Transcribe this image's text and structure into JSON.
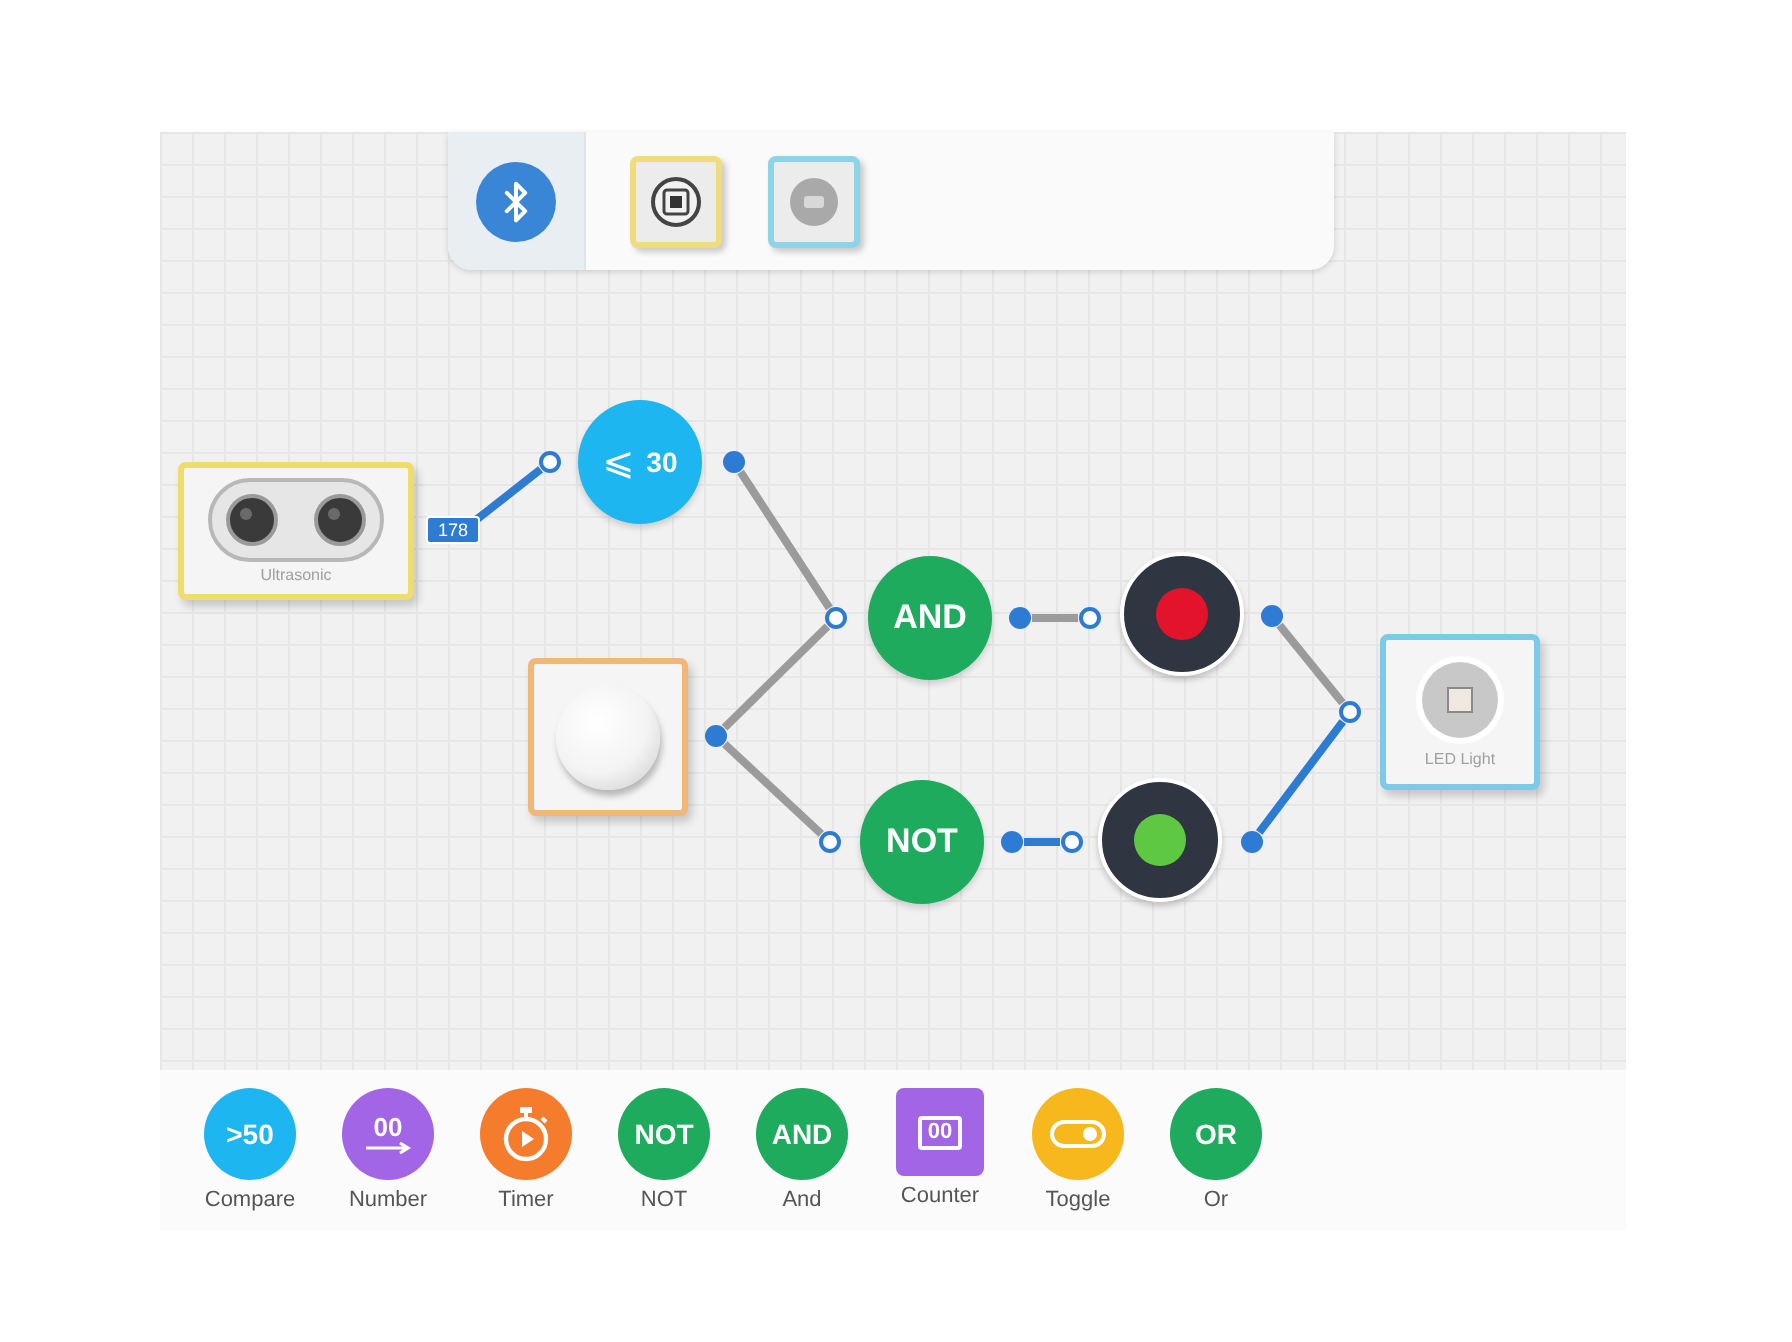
{
  "toolbar": {
    "tiles": [
      {
        "kind": "chip",
        "color": "#f0dc7c"
      },
      {
        "kind": "disc",
        "color": "#8ed4e8"
      }
    ]
  },
  "canvas": {
    "modules": [
      {
        "kind": "ultrasonic",
        "label": "Ultrasonic",
        "color": "#f0dc6a",
        "reading": "178"
      },
      {
        "kind": "button",
        "color": "#f2b777"
      },
      {
        "kind": "led",
        "label": "LED Light",
        "color": "#7ccbe6"
      }
    ],
    "nodes": [
      {
        "kind": "compare",
        "symbol": "⩽",
        "value": "30",
        "color": "#1eb6f0"
      },
      {
        "kind": "gate",
        "label": "AND",
        "color": "#1eab5e"
      },
      {
        "kind": "gate",
        "label": "NOT",
        "color": "#1eab5e"
      }
    ],
    "lights": [
      {
        "color": "#e3132b"
      },
      {
        "color": "#5fc843"
      }
    ],
    "wires": [
      {
        "active": true
      },
      {
        "active": false
      },
      {
        "active": false
      },
      {
        "active": false
      },
      {
        "active": false
      },
      {
        "active": true
      },
      {
        "active": false
      },
      {
        "active": true
      }
    ]
  },
  "palette": [
    {
      "kind": "text",
      "glyph": ">50",
      "label": "Compare",
      "color": "#1eb6f0"
    },
    {
      "kind": "number",
      "glyph": "00",
      "label": "Number",
      "color": "#a165e6"
    },
    {
      "kind": "timer",
      "label": "Timer",
      "color": "#f47c2c"
    },
    {
      "kind": "text",
      "glyph": "NOT",
      "label": "NOT",
      "color": "#1eab5e"
    },
    {
      "kind": "text",
      "glyph": "AND",
      "label": "And",
      "color": "#1eab5e"
    },
    {
      "kind": "counter",
      "glyph": "00",
      "label": "Counter",
      "color": "#a165e6"
    },
    {
      "kind": "toggle",
      "label": "Toggle",
      "color": "#f6b81c"
    },
    {
      "kind": "text",
      "glyph": "OR",
      "label": "Or",
      "color": "#1eab5e"
    }
  ]
}
